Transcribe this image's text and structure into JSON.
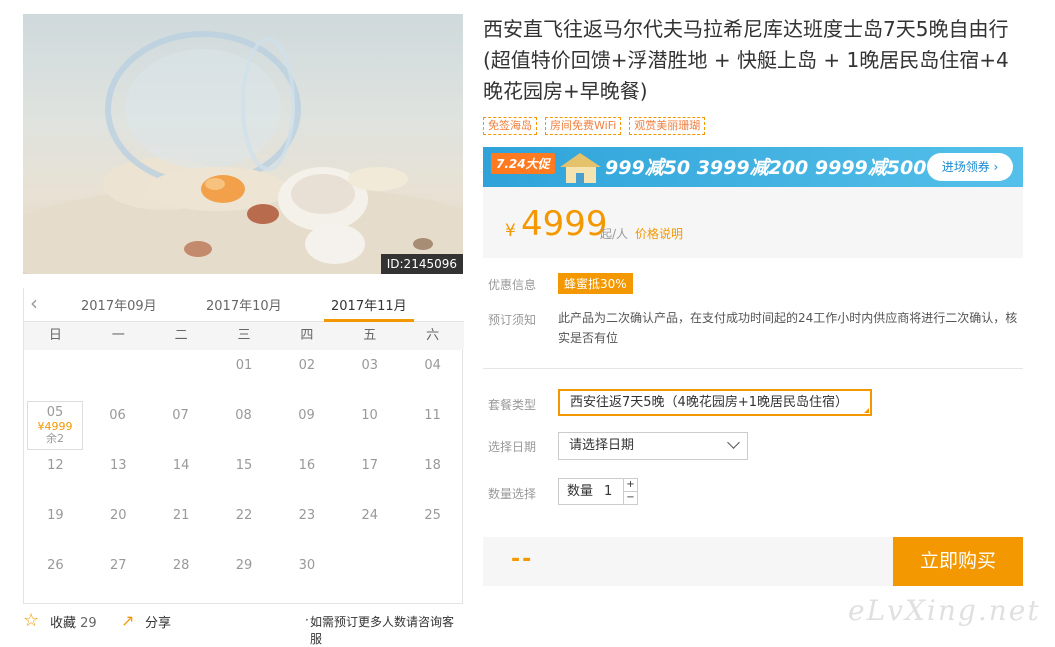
{
  "photo": {
    "id_label": "ID:2145096"
  },
  "calendar": {
    "months": [
      "2017年09月",
      "2017年10月",
      "2017年11月"
    ],
    "active_month_index": 2,
    "weekdays": [
      "日",
      "一",
      "二",
      "三",
      "四",
      "五",
      "六"
    ],
    "rows": [
      [
        "",
        "",
        "",
        "01",
        "02",
        "03",
        "04"
      ],
      [
        "05",
        "06",
        "07",
        "08",
        "09",
        "10",
        "11"
      ],
      [
        "12",
        "13",
        "14",
        "15",
        "16",
        "17",
        "18"
      ],
      [
        "19",
        "20",
        "21",
        "22",
        "23",
        "24",
        "25"
      ],
      [
        "26",
        "27",
        "28",
        "29",
        "30",
        "",
        ""
      ]
    ],
    "selected": {
      "day": "05",
      "price": "¥4999",
      "remain": "余2"
    }
  },
  "actions": {
    "favorite_label": "收藏",
    "favorite_count": "29",
    "share_label": "分享",
    "note": "如需预订更多人数请咨询客服"
  },
  "product": {
    "title": "西安直飞往返马尔代夫马拉希尼库达班度士岛7天5晚自由行(超值特价回馈+浮潜胜地 + 快艇上岛 + 1晚居民岛住宿+4晚花园房+早晚餐)",
    "tags": [
      "免签海岛",
      "房间免费WiFi",
      "观赏美丽珊瑚"
    ]
  },
  "banner": {
    "promo": "7.24大促",
    "offers": "999减50  3999减200  9999减500",
    "button": "进场领券 ›"
  },
  "price": {
    "currency": "¥",
    "value": "4999",
    "unit": "起/人",
    "note": "价格说明"
  },
  "info": {
    "discount_label": "优惠信息",
    "discount_tag": "蜂蜜抵30%",
    "notice_label": "预订须知",
    "notice_text": "此产品为二次确认产品，在支付成功时间起的24工作小时内供应商将进行二次确认，核实是否有位"
  },
  "form": {
    "package_label": "套餐类型",
    "package_value": "西安往返7天5晚（4晚花园房+1晚居民岛住宿）",
    "date_label": "选择日期",
    "date_placeholder": "请选择日期",
    "qty_label": "数量选择",
    "qty_prefix": "数量",
    "qty_value": "1",
    "qty_plus": "+",
    "qty_minus": "−"
  },
  "buy": {
    "total": "--",
    "button": "立即购买"
  },
  "watermark": "eLvXing.net",
  "colors": {
    "accent": "#f39800",
    "banner": "#2fa3d9"
  }
}
